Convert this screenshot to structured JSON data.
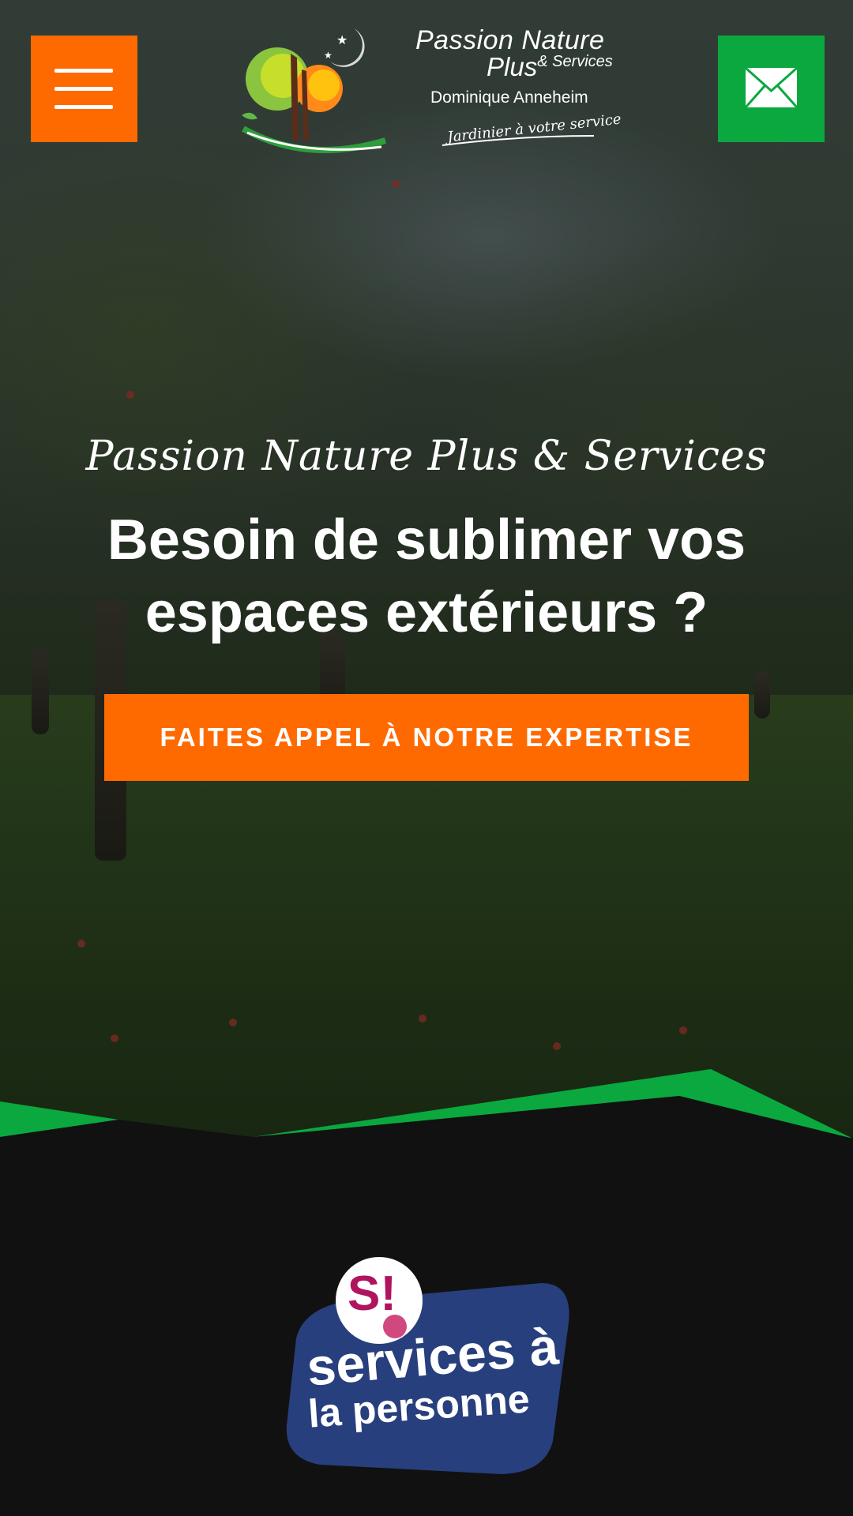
{
  "header": {
    "menu_icon": "hamburger-menu-icon",
    "contact_icon": "envelope-icon",
    "brand": {
      "name_line1": "Passion Nature",
      "name_line2": "Plus",
      "name_suffix": "& Services",
      "owner": "Dominique Anneheim",
      "tagline": "Jardinier à votre service"
    }
  },
  "hero": {
    "kicker": "Passion Nature Plus & Services",
    "headline": "Besoin de sublimer vos espaces extérieurs ?",
    "cta_label": "FAITES APPEL À NOTRE EXPERTISE"
  },
  "badge": {
    "si_label": "S!",
    "line1": "services à",
    "line2": "la personne"
  },
  "colors": {
    "accent_orange": "#ff6a00",
    "accent_green": "#0aa83f",
    "dark_background": "#111111",
    "badge_blue": "#283f7d",
    "badge_magenta": "#b0145e"
  }
}
